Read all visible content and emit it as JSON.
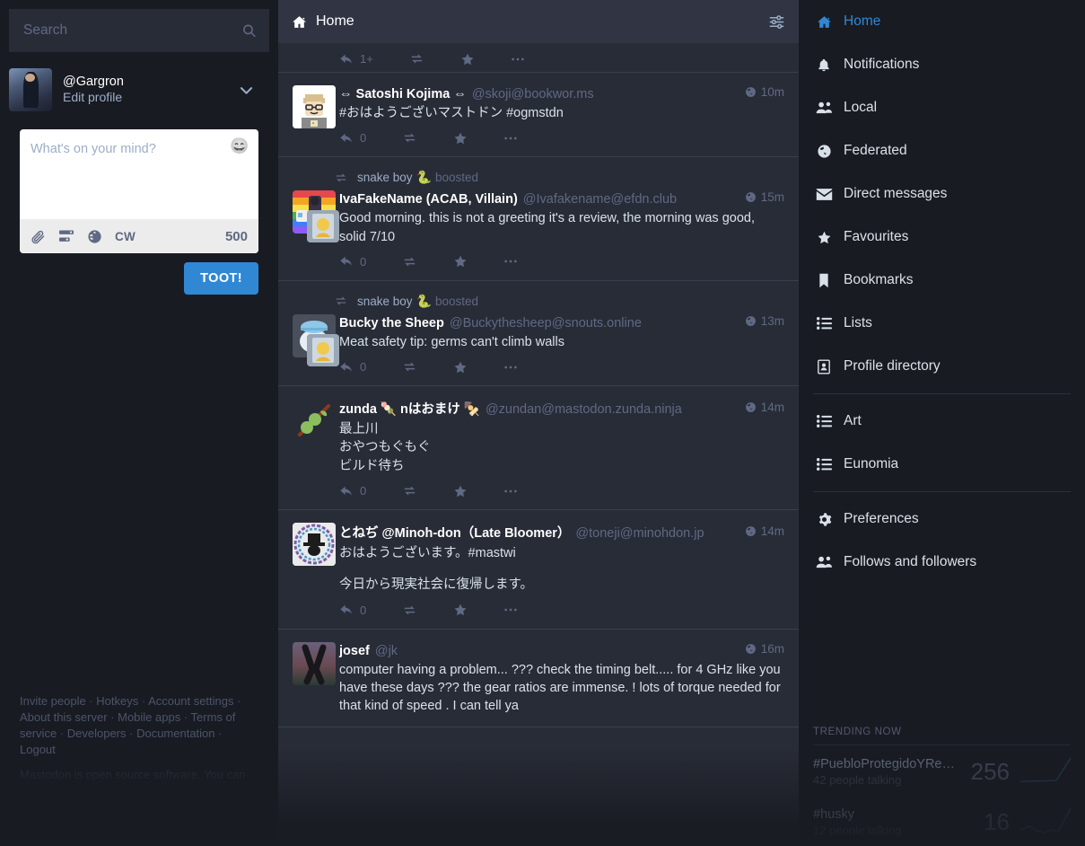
{
  "search": {
    "placeholder": "Search",
    "value": ""
  },
  "account": {
    "handle": "@Gargron",
    "edit_label": "Edit profile"
  },
  "compose": {
    "placeholder": "What's on your mind?",
    "emoji": "emoji-picker",
    "cw_label": "CW",
    "char_count": "500",
    "toot_label": "TOOT!"
  },
  "footer": {
    "links": [
      "Invite people",
      "Hotkeys",
      "Account settings",
      "About this server",
      "Mobile apps",
      "Terms of service",
      "Developers",
      "Documentation",
      "Logout"
    ],
    "note": "Mastodon is open source software. You can contribute or report issues on GitHub at"
  },
  "column": {
    "title": "Home"
  },
  "timeline": [
    {
      "partial": true,
      "reply_count": "1+",
      "display_name": "",
      "handle": "",
      "time": "",
      "content": ""
    },
    {
      "display_name": "⇔ Satoshi Kojima ⇔",
      "handle": "@skoji@bookwor.ms",
      "time": "10m",
      "content": "#おはようございマストドン #ogmstdn",
      "reply_count": "0"
    },
    {
      "boosted_by": "snake boy",
      "boost_label": "boosted",
      "display_name": "IvaFakeName (ACAB, Villain)",
      "handle": "@Ivafakename@efdn.club",
      "time": "15m",
      "content": "Good morning. this is not a greeting it's a review, the morning was good, solid 7/10",
      "reply_count": "0"
    },
    {
      "boosted_by": "snake boy",
      "boost_label": "boosted",
      "display_name": "Bucky the Sheep",
      "handle": "@Buckythesheep@snouts.online",
      "time": "13m",
      "content": "Meat safety tip: germs can't climb walls",
      "reply_count": "0"
    },
    {
      "display_name": "zunda 🍡 nはおまけ 🍢",
      "handle": "@zundan@mastodon.zunda.ninja",
      "time": "14m",
      "content": "最上川\nおやつもぐもぐ\nビルド待ち",
      "reply_count": "0"
    },
    {
      "display_name": "とねぢ @Minoh-don（Late Bloomer）",
      "handle": "@toneji@minohdon.jp",
      "time": "14m",
      "content_1": "おはようございます。#mastwi",
      "content_2": "今日から現実社会に復帰します。",
      "reply_count": "0"
    },
    {
      "display_name": "josef",
      "handle": "@jk",
      "time": "16m",
      "content": "computer having a problem... ??? check the timing belt..... for 4 GHz like you have these days ??? the gear ratios are immense. ! lots of torque needed for that kind of speed . I can tell ya",
      "reply_count": ""
    }
  ],
  "nav": {
    "items": [
      {
        "label": "Home",
        "icon": "home-icon",
        "active": true
      },
      {
        "label": "Notifications",
        "icon": "bell-icon",
        "active": false
      },
      {
        "label": "Local",
        "icon": "users-icon",
        "active": false
      },
      {
        "label": "Federated",
        "icon": "globe-icon",
        "active": false
      },
      {
        "label": "Direct messages",
        "icon": "envelope-icon",
        "active": false
      },
      {
        "label": "Favourites",
        "icon": "star-icon",
        "active": false
      },
      {
        "label": "Bookmarks",
        "icon": "bookmark-icon",
        "active": false
      },
      {
        "label": "Lists",
        "icon": "list-icon",
        "active": false
      },
      {
        "label": "Profile directory",
        "icon": "address-book-icon",
        "active": false
      }
    ],
    "lists": [
      {
        "label": "Art",
        "icon": "list-icon"
      },
      {
        "label": "Eunomia",
        "icon": "list-icon"
      }
    ],
    "settings": [
      {
        "label": "Preferences",
        "icon": "gear-icon"
      },
      {
        "label": "Follows and followers",
        "icon": "users-icon"
      }
    ]
  },
  "trending": {
    "title": "TRENDING NOW",
    "items": [
      {
        "tag": "#PuebloProtegidoYRe…",
        "people": "42 people talking",
        "count": "256"
      },
      {
        "tag": "#husky",
        "people": "12 people talking",
        "count": "16"
      }
    ]
  },
  "colors": {
    "accent": "#3088d4",
    "bg_dark": "#191b22",
    "bg_mid": "#282c37",
    "bg_header": "#313543",
    "text": "#d9e1e8",
    "muted": "#606984"
  }
}
